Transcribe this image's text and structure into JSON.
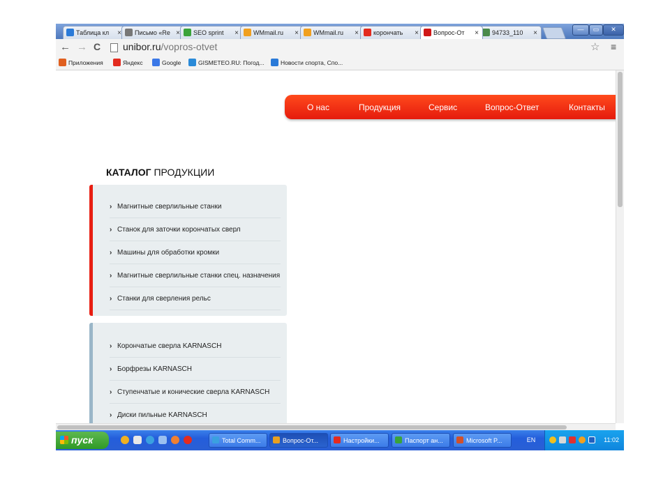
{
  "browser": {
    "tabs": [
      {
        "label": "Таблица кл",
        "icon": "sb-icon",
        "color": "#2a7ad8"
      },
      {
        "label": "Письмо «Re",
        "icon": "mail-icon",
        "color": "#777777"
      },
      {
        "label": "SEO sprint",
        "icon": "seo-sprint-icon",
        "color": "#3aa33a"
      },
      {
        "label": "WMmail.ru",
        "icon": "wmmail-icon",
        "color": "#f0a020"
      },
      {
        "label": "WMmail.ru",
        "icon": "wmmail-icon",
        "color": "#f0a020"
      },
      {
        "label": "корончать",
        "icon": "yandex-icon",
        "color": "#e32b1f"
      },
      {
        "label": "Вопрос-От",
        "icon": "unibor-icon",
        "color": "#d01818"
      },
      {
        "label": "94733_110",
        "icon": "image-icon",
        "color": "#4a8a4a"
      }
    ],
    "tab_close": "×",
    "window_buttons": {
      "minimize": "—",
      "maximize": "▭",
      "close": "✕"
    },
    "nav": {
      "back": "←",
      "forward": "→",
      "reload": "C"
    },
    "url_host": "unibor.ru",
    "url_path": "/vopros-otvet",
    "star": "☆",
    "menu": "≡",
    "bookmarks": [
      {
        "label": "Приложения",
        "icon": "apps-icon",
        "color": "#e06020"
      },
      {
        "label": "Яндекс",
        "icon": "yandex-icon",
        "color": "#e32b1f"
      },
      {
        "label": "Google",
        "icon": "google-icon",
        "color": "#3b78e7"
      },
      {
        "label": "GISMETEO.RU: Погод...",
        "icon": "gismeteo-icon",
        "color": "#2a8ad8"
      },
      {
        "label": "Новости спорта, Спо...",
        "icon": "sb-icon",
        "color": "#2a7ad8"
      }
    ]
  },
  "site": {
    "nav": [
      "О нас",
      "Продукция",
      "Сервис",
      "Вопрос-Ответ",
      "Контакты"
    ],
    "catalog_title_bold": "КАТАЛОГ",
    "catalog_title_rest": " ПРОДУКЦИИ",
    "chevron": "›",
    "group1": [
      "Магнитные сверлильные станки",
      "Станок для заточки корончатых сверл",
      "Машины для обработки кромки",
      "Магнитные сверлильные станки спец. назначения",
      "Станки для сверления рельс"
    ],
    "group2": [
      "Корончатые сверла KARNASCH",
      "Борфрезы KARNASCH",
      "Ступенчатые и конические сверла KARNASCH",
      "Диски пильные KARNASCH"
    ],
    "accent_color": "#e81e12"
  },
  "taskbar": {
    "start_label": "пуск",
    "tasks": [
      {
        "label": "Total Comm...",
        "icon": "total-commander-icon",
        "color": "#3aa0e0"
      },
      {
        "label": "Вопрос-От...",
        "icon": "chrome-icon",
        "color": "#e8a020"
      },
      {
        "label": "Настройки...",
        "icon": "yandex-browser-icon",
        "color": "#e32b1f"
      },
      {
        "label": "Паспорт ан...",
        "icon": "document-icon",
        "color": "#3aa33a"
      },
      {
        "label": "Microsoft P...",
        "icon": "powerpoint-icon",
        "color": "#d2502a"
      }
    ],
    "lang": "EN",
    "clock": "11:02"
  }
}
